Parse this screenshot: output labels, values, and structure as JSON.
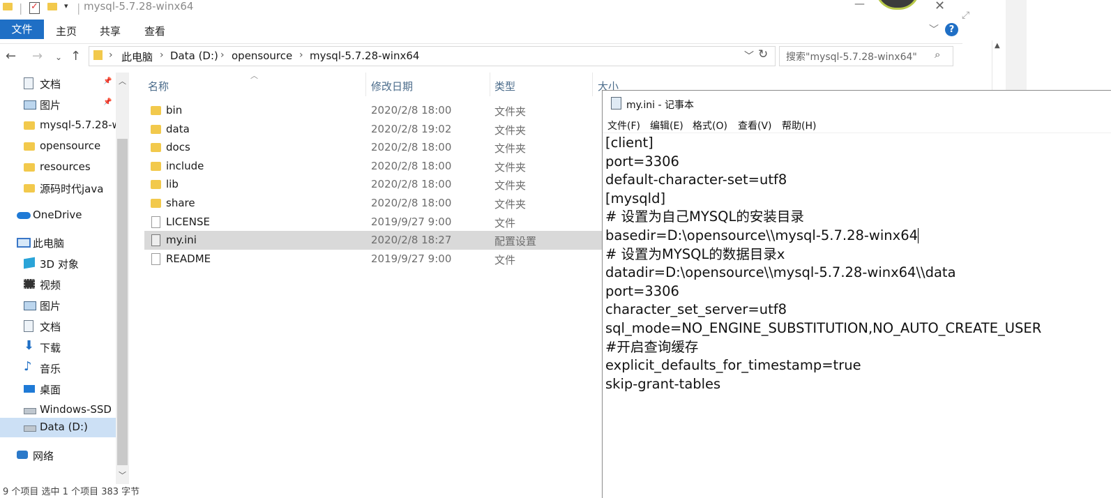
{
  "explorer": {
    "window_title": "mysql-5.7.28-winx64",
    "ribbon_tabs": [
      "文件",
      "主页",
      "共享",
      "查看"
    ],
    "breadcrumb": [
      "此电脑",
      "Data (D:)",
      "opensource",
      "mysql-5.7.28-winx64"
    ],
    "search_placeholder": "搜索\"mysql-5.7.28-winx64\"",
    "nav_items": [
      {
        "label": "文档",
        "icon": "document-icon",
        "pinned": true
      },
      {
        "label": "图片",
        "icon": "picture-icon",
        "pinned": true
      },
      {
        "label": "mysql-5.7.28-w",
        "icon": "folder-icon"
      },
      {
        "label": "opensource",
        "icon": "folder-icon"
      },
      {
        "label": "resources",
        "icon": "folder-icon"
      },
      {
        "label": "源码时代java",
        "icon": "folder-icon"
      },
      {
        "label": "OneDrive",
        "icon": "onedrive-icon"
      },
      {
        "label": "此电脑",
        "icon": "computer-icon"
      },
      {
        "label": "3D 对象",
        "icon": "3d-objects-icon"
      },
      {
        "label": "视频",
        "icon": "video-icon"
      },
      {
        "label": "图片",
        "icon": "picture-icon"
      },
      {
        "label": "文档",
        "icon": "document-icon"
      },
      {
        "label": "下载",
        "icon": "download-icon"
      },
      {
        "label": "音乐",
        "icon": "music-icon"
      },
      {
        "label": "桌面",
        "icon": "desktop-icon"
      },
      {
        "label": "Windows-SSD (",
        "icon": "drive-icon"
      },
      {
        "label": "Data (D:)",
        "icon": "drive-icon",
        "selected": true
      },
      {
        "label": "网络",
        "icon": "network-icon"
      }
    ],
    "columns": [
      "名称",
      "修改日期",
      "类型",
      "大小"
    ],
    "files": [
      {
        "name": "bin",
        "date": "2020/2/8 18:00",
        "type": "文件夹",
        "kind": "folder"
      },
      {
        "name": "data",
        "date": "2020/2/8 19:02",
        "type": "文件夹",
        "kind": "folder"
      },
      {
        "name": "docs",
        "date": "2020/2/8 18:00",
        "type": "文件夹",
        "kind": "folder"
      },
      {
        "name": "include",
        "date": "2020/2/8 18:00",
        "type": "文件夹",
        "kind": "folder"
      },
      {
        "name": "lib",
        "date": "2020/2/8 18:00",
        "type": "文件夹",
        "kind": "folder"
      },
      {
        "name": "share",
        "date": "2020/2/8 18:00",
        "type": "文件夹",
        "kind": "folder"
      },
      {
        "name": "LICENSE",
        "date": "2019/9/27 9:00",
        "type": "文件",
        "kind": "file"
      },
      {
        "name": "my.ini",
        "date": "2020/2/8 18:27",
        "type": "配置设置",
        "kind": "ini",
        "selected": true
      },
      {
        "name": "README",
        "date": "2019/9/27 9:00",
        "type": "文件",
        "kind": "file"
      }
    ],
    "status_text": "9 个项目   选中 1 个项目 383 字节"
  },
  "notepad": {
    "title": "my.ini - 记事本",
    "menu": [
      "文件(F)",
      "编辑(E)",
      "格式(O)",
      "查看(V)",
      "帮助(H)"
    ],
    "lines": [
      "[client]",
      "port=3306",
      "default-character-set=utf8",
      "[mysqld]",
      "# 设置为自己MYSQL的安装目录",
      "basedir=D:\\opensource\\\\mysql-5.7.28-winx64",
      "# 设置为MYSQL的数据目录x",
      "datadir=D:\\opensource\\\\mysql-5.7.28-winx64\\\\data",
      "port=3306",
      "character_set_server=utf8",
      "sql_mode=NO_ENGINE_SUBSTITUTION,NO_AUTO_CREATE_USER",
      "#开启查询缓存",
      "explicit_defaults_for_timestamp=true",
      "skip-grant-tables"
    ]
  }
}
